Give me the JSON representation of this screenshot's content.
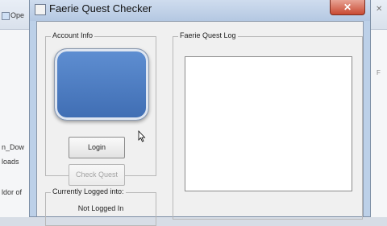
{
  "background": {
    "left_toolbar_text": "Ope",
    "left_texts": [
      "n_Dow",
      "loads",
      "ldor of"
    ]
  },
  "window": {
    "title": "Faerie Quest Checker",
    "close_glyph": "✕"
  },
  "account_info": {
    "label": "Account Info",
    "login_button": "Login",
    "check_quest_button": "Check Quest"
  },
  "status": {
    "label": "Currently Logged into:",
    "value": "Not Logged In"
  },
  "log": {
    "label": "Faerie Quest Log",
    "content": ""
  }
}
